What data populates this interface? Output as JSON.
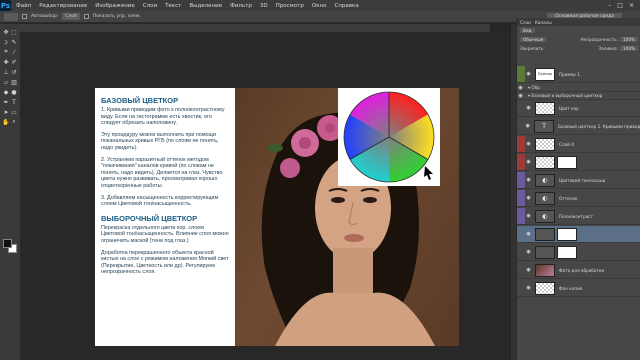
{
  "app": {
    "logo": "Ps"
  },
  "menu": [
    "Файл",
    "Редактирование",
    "Изображение",
    "Слои",
    "Текст",
    "Выделение",
    "Фильтр",
    "3D",
    "Просмотр",
    "Окно",
    "Справка"
  ],
  "window_controls": {
    "minimize": "–",
    "maximize": "□",
    "close": "×"
  },
  "options": {
    "autoselect_label": "Автовыбор:",
    "autoselect_value": "Слой",
    "show_controls_label": "Показать упр. элем."
  },
  "workspace": "Основная рабочая среда",
  "tools": [
    {
      "icon": "move-icon",
      "glyph": "✥"
    },
    {
      "icon": "marquee-icon",
      "glyph": "⬚"
    },
    {
      "icon": "lasso-icon",
      "glyph": "ↄ"
    },
    {
      "icon": "quick-select-icon",
      "glyph": "✎"
    },
    {
      "icon": "crop-icon",
      "glyph": "⌗"
    },
    {
      "icon": "eyedropper-icon",
      "glyph": "⁄"
    },
    {
      "icon": "healing-icon",
      "glyph": "✚"
    },
    {
      "icon": "brush-icon",
      "glyph": "✐"
    },
    {
      "icon": "stamp-icon",
      "glyph": "⊥"
    },
    {
      "icon": "history-brush-icon",
      "glyph": "↺"
    },
    {
      "icon": "eraser-icon",
      "glyph": "▱"
    },
    {
      "icon": "gradient-icon",
      "glyph": "▥"
    },
    {
      "icon": "blur-icon",
      "glyph": "◆"
    },
    {
      "icon": "dodge-icon",
      "glyph": "●"
    },
    {
      "icon": "pen-icon",
      "glyph": "✒"
    },
    {
      "icon": "type-icon",
      "glyph": "T"
    },
    {
      "icon": "path-select-icon",
      "glyph": "➤"
    },
    {
      "icon": "shape-icon",
      "glyph": "▭"
    },
    {
      "icon": "hand-icon",
      "glyph": "✋"
    },
    {
      "icon": "zoom-icon",
      "glyph": "⌕"
    }
  ],
  "colors": {
    "accent_blue": "#1b5e85",
    "layer_red": "#9b3b3b",
    "layer_violet": "#6b5a9e",
    "layer_green": "#5c7a3a",
    "selected": "#5b6f88"
  },
  "article": {
    "title1": "БАЗОВЫЙ ЦВЕТКОР",
    "p1": "1. Кривыми приводим фото к полноконтрастному виду. Если на гистограмме есть хвостик, его следует обрезать наполовину.",
    "p2": "Эту процедуру можно выполнить при помощи поканальных кривых РГБ (по слоям не понять, надо увидеть).",
    "p3": "2. Устраняем паразитный оттенок методом \"покачивания\" каналов кривой (по словам не понять, надо видеть). Делается на глаз. Чувство цвета нужно развивать, просматривая хорошо отцветкоренные работы.",
    "p4": "3. Добавляем насыщенность корректирующим слоем Цветовой тон/насыщенность.",
    "title2": "ВЫБОРОЧНЫЙ ЦВЕТКОР",
    "p5": "Перекраска отдельного цвета кор. слоем Цветовой тон/насыщенность. Влияние слоя можно ограничить маской (тени под глаз.)",
    "p6": "Доработка перекрашенного объекта красной кистью на слое с режимом наложения Мягкий свет (Перекрытие, Цветность или др). Регулируем непрозрачность слоя."
  },
  "panel": {
    "tabs": [
      "Слои",
      "Каналы"
    ],
    "kind_label": "Вид",
    "blend_mode": "Обычные",
    "opacity_label": "Непрозрачность:",
    "opacity_value": "100%",
    "lock_label": "Закрепить:",
    "fill_label": "Заливка:",
    "fill_value": "100%",
    "layers": [
      {
        "name": "Пример 1",
        "thumb_text": "Пример",
        "color": "#5c7a3a",
        "kind": "text",
        "selected": false,
        "mask": false
      },
      {
        "name": "Цвет кор",
        "thumb_text": "",
        "color": "",
        "kind": "normal",
        "selected": false,
        "mask": false
      },
      {
        "name": "Базовый цветкор 1. Кривыми приводим",
        "thumb_text": "T",
        "color": "",
        "kind": "adj",
        "selected": false,
        "mask": false
      },
      {
        "name": "Слой 4",
        "thumb_text": "",
        "color": "#9b3b3b",
        "kind": "normal",
        "selected": false,
        "mask": false
      },
      {
        "name": "",
        "thumb_text": "",
        "color": "#9b3b3b",
        "kind": "normal",
        "selected": false,
        "mask": true
      },
      {
        "name": "Цветовой тон/насыщ",
        "thumb_text": "◐",
        "color": "#6b5a9e",
        "kind": "adj",
        "selected": false,
        "mask": false
      },
      {
        "name": "Оттенок",
        "thumb_text": "◐",
        "color": "#6b5a9e",
        "kind": "adj",
        "selected": false,
        "mask": false
      },
      {
        "name": "Полноконтраст",
        "thumb_text": "◐",
        "color": "#6b5a9e",
        "kind": "adj",
        "selected": false,
        "mask": false
      },
      {
        "name": "",
        "thumb_text": "",
        "color": "",
        "kind": "adj",
        "selected": true,
        "mask": true
      },
      {
        "name": "",
        "thumb_text": "",
        "color": "",
        "kind": "adj",
        "selected": false,
        "mask": true
      },
      {
        "name": "Фото для обработки",
        "thumb_text": "",
        "color": "",
        "kind": "photo",
        "selected": false,
        "mask": false
      },
      {
        "name": "Фон копия",
        "thumb_text": "",
        "color": "",
        "kind": "normal",
        "selected": false,
        "mask": false
      }
    ],
    "groups": [
      "Обр.",
      "Базовый и выборочный цветкор"
    ]
  }
}
